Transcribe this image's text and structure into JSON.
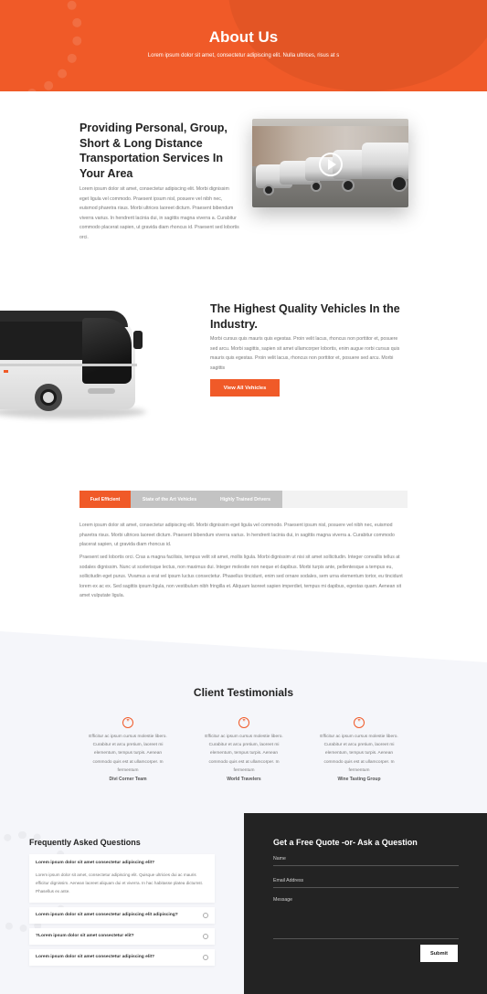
{
  "hero": {
    "title": "About Us",
    "subtitle": "Lorem ipsum dolor sit amet, consectetur adipiscing elit. Nulla ultrices, risus at s"
  },
  "intro": {
    "heading": "Providing Personal, Group, Short & Long Distance Transportation Services In Your Area",
    "body": "Lorem ipsum dolor sit amet, consectetur adipiscing elit. Morbi dignissim eget ligula vel commodo. Praesent ipsum nisl, posuere vel nibh nec, euismod pharetra risus. Morbi ultrices laoreet dictum. Praesent bibendum viverra varius. In hendrerit lacinia dui, in sagittis magna viverra a. Curabitur commodo placerat sapien, ut gravida diam rhoncus id. Praesent sed lobortis orci."
  },
  "vehicles": {
    "heading": "The Highest Quality Vehicles In the Industry.",
    "body": "Morbi cursus quis mauris quis egestas. Proin velit lacus, rhoncus non porttitor et, posuere sed arcu. Morbi sagittis, sapien sit amet ullamcorper lobortis, enim augue rorbi cursus quis mauris quis egestas. Proin velit lacus, rhoncus non porttitor et, posuere sed arcu. Morbi sagittis",
    "button": "View All Vehicles"
  },
  "tabs": {
    "items": [
      "Fuel Efficient",
      "State of the Art Vehicles",
      "Highly Trained Drivers"
    ],
    "paragraph1": "Lorem ipsum dolor sit amet, consectetur adipiscing elit. Morbi dignissim eget ligula vel commodo. Praesent ipsum nisl, posuere vel nibh nec, euismod pharetra risus. Morbi ultrices laoreet dictum. Praesent bibendum viverra varius. In hendrerit lacinia dui, in sagittis magna viverra a. Curabitur commodo placerat sapien, ut gravida diam rhoncus id.",
    "paragraph2": "Praesent sed lobortis orci. Cras a magna facilisis, tempus velit sit amet, mollis ligula. Morbi dignissim ut nisi sit amet sollicitudin. Integer convallis tellus at sodales dignissim. Nunc ut scelerisque lectus, non maximus dui. Integer molestie non neque et dapibus. Morbi turpis ante, pellentesque a tempus eu, sollicitudin eget purus. Vivamus a erat vel ipsum luctus consectetur. Phasellus tincidunt, enim sed ornare sodales, sem urna elementum tortor, eu tincidunt lorem ex ac ex. Sed sagittis ipsum ligula, non vestibulum nibh fringilla et. Aliquam laoreet sapien imperdiet, tempus mi dapibus, egestas quam. Aenean sit amet vulputate ligula."
  },
  "testimonials": {
    "title": "Client Testimonials",
    "items": [
      {
        "text": "Efficitur ac ipsum cursus molestie libero. Curabitur et arcu pretium, laoreet mi elementum, tempus turpis. Aenean commodo quis est at ullamcorper. In fermentum",
        "name": "Divi Corner Team"
      },
      {
        "text": "Efficitur ac ipsum cursus molestie libero. Curabitur et arcu pretium, laoreet mi elementum, tempus turpis. Aenean commodo quis est at ullamcorper. In fermentum",
        "name": "World Travelers"
      },
      {
        "text": "Efficitur ac ipsum cursus molestie libero. Curabitur et arcu pretium, laoreet mi elementum, tempus turpis. Aenean commodo quis est at ullamcorper. In fermentum",
        "name": "Wine Tasting Group"
      }
    ],
    "quote_glyph": "”"
  },
  "faq": {
    "title": "Frequently Asked Questions",
    "items": [
      {
        "question": "Lorem ipsum dolor sit amet consectetur adipiscing elit?",
        "answer": "Lorem ipsum dolor sit amet, consectetur adipiscing elit. Quisque ultricies dui ac mauris efficitur dignissim. Aenean laoreet aliquam dui et viverra. In hac habitasse platea dictumst. Phasellus ex ante."
      },
      {
        "question": "Lorem ipsum dolor sit amet consectetur adipiscing elit adipiscing?"
      },
      {
        "question": "?Lorem ipsum dolor sit amet consectetur elit?"
      },
      {
        "question": "Lorem ipsum dolor sit amet consectetur adipiscing elit?"
      }
    ]
  },
  "quote_form": {
    "title": "Get a Free Quote -or- Ask a Question",
    "name_placeholder": "Name",
    "email_placeholder": "Email Address",
    "message_placeholder": "Message",
    "submit": "Submit"
  },
  "colors": {
    "accent": "#f05a28",
    "dark": "#232323",
    "light_bg": "#f5f6fa",
    "tab_inactive": "#c3c3c3"
  }
}
